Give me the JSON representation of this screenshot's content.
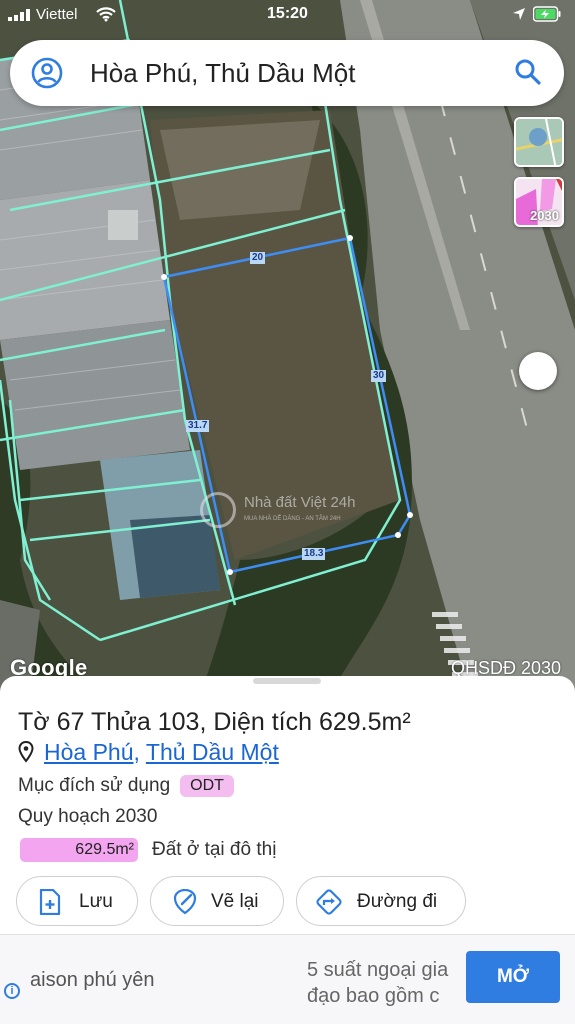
{
  "status_bar": {
    "carrier": "Viettel",
    "time": "15:20"
  },
  "search": {
    "query": "Hòa Phú, Thủ Dầu Một",
    "avatar_icon": "person-icon",
    "search_icon": "search-icon"
  },
  "map": {
    "provider": "Google",
    "layer_label": "QHSDĐ 2030",
    "layer_thumb_year": "2030",
    "parcel_dimensions": {
      "top": "20",
      "right": "30",
      "left": "31.7",
      "bottom": "18.3"
    },
    "watermark": {
      "title": "Nhà đất Việt 24h",
      "subtitle": "MUA NHÀ DỄ DÀNG - AN TÂM 24H"
    }
  },
  "parcel": {
    "sheet_label": "Tờ",
    "sheet_number": "67",
    "plot_label": "Thửa",
    "plot_number": "103",
    "area_label": "Diện tích",
    "area": "629.5m²",
    "ward": "Hòa Phú",
    "city": "Thủ Dầu Một",
    "purpose_label": "Mục đích sử dụng",
    "purpose_code": "ODT",
    "plan_label": "Quy hoạch 2030",
    "plan_area": "629.5m²",
    "plan_use": "Đất ở tại đô thị",
    "plan_color": "#f3a6ef"
  },
  "actions": {
    "save": "Lưu",
    "redraw": "Vẽ lại",
    "directions": "Đường đi"
  },
  "ad": {
    "left_text": "aison phú yên",
    "line1": "5 suất ngoại gia",
    "line2": "đạo bao gồm c",
    "cta": "MỞ"
  }
}
